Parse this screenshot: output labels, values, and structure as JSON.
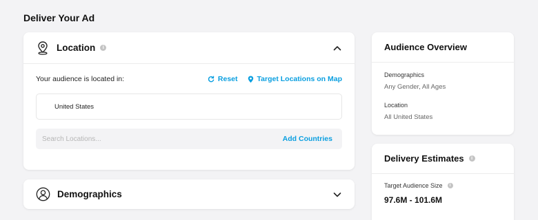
{
  "page_title": "Deliver Your Ad",
  "location": {
    "title": "Location",
    "audience_label": "Your audience is located in:",
    "reset_label": "Reset",
    "map_label": "Target Locations on Map",
    "selected": "United States",
    "search_placeholder": "Search Locations...",
    "add_countries_label": "Add Countries"
  },
  "demographics": {
    "title": "Demographics"
  },
  "audience_overview": {
    "title": "Audience Overview",
    "demographics_label": "Demographics",
    "demographics_value": "Any Gender, All Ages",
    "location_label": "Location",
    "location_value": "All United States"
  },
  "delivery_estimates": {
    "title": "Delivery Estimates",
    "target_size_label": "Target Audience Size",
    "target_size_value": "97.6M - 101.6M"
  },
  "colors": {
    "accent": "#0a9fe0",
    "background": "#f3f3f5"
  },
  "icons": [
    "map-pin-icon",
    "info-icon",
    "chevron-up-icon",
    "reset-icon",
    "location-pin-icon",
    "user-icon",
    "chevron-down-icon"
  ]
}
